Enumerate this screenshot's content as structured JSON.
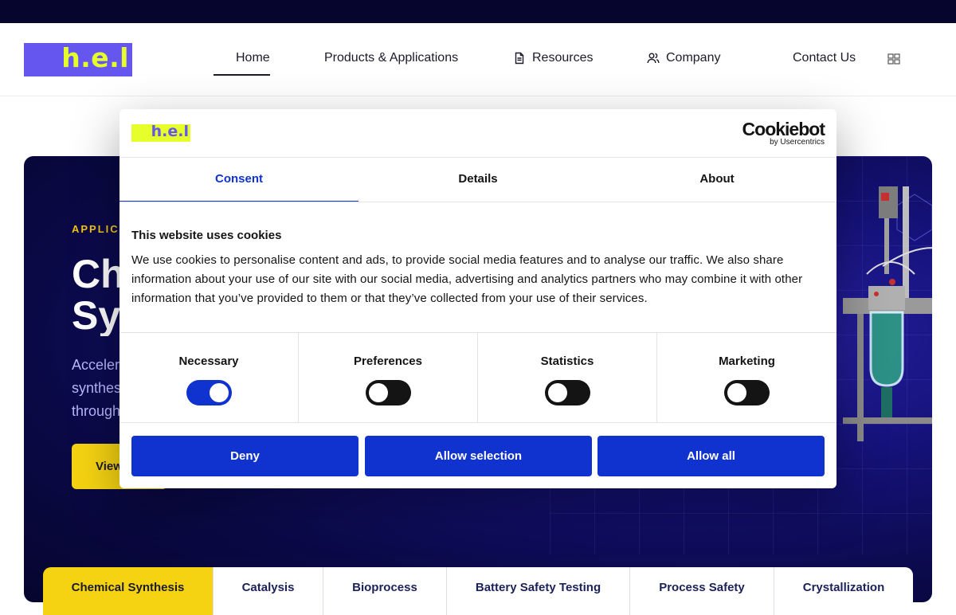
{
  "header": {
    "logo_text": "h.e.l",
    "nav": [
      {
        "label": "Home",
        "icon": null
      },
      {
        "label": "Products & Applications",
        "icon": null
      },
      {
        "label": "Resources",
        "icon": "document-icon"
      },
      {
        "label": "Company",
        "icon": "users-icon"
      },
      {
        "label": "Contact Us",
        "icon": null
      }
    ],
    "active_nav": "Home"
  },
  "hero": {
    "eyebrow": "APPLICA",
    "title_line1": "Ch",
    "title_line2": "Sy",
    "subtitle_line1": "Acceler",
    "subtitle_line2": "synthes",
    "subtitle_line3": "through",
    "button_label": "View"
  },
  "application_tabs": [
    "Chemical Synthesis",
    "Catalysis",
    "Bioprocess",
    "Battery Safety Testing",
    "Process Safety",
    "Crystallization"
  ],
  "cookie_dialog": {
    "logo_text": "h.e.l",
    "provider_name": "Cookiebot",
    "provider_sub": "by Usercentrics",
    "tabs": [
      "Consent",
      "Details",
      "About"
    ],
    "active_tab": "Consent",
    "heading": "This website uses cookies",
    "body": "We use cookies to personalise content and ads, to provide social media features and to analyse our traffic. We also share information about your use of our site with our social media, advertising and analytics partners who may combine it with other information that you’ve provided to them or that they’ve collected from your use of their services.",
    "categories": [
      {
        "label": "Necessary",
        "enabled": true
      },
      {
        "label": "Preferences",
        "enabled": false
      },
      {
        "label": "Statistics",
        "enabled": false
      },
      {
        "label": "Marketing",
        "enabled": false
      }
    ],
    "buttons": {
      "deny": "Deny",
      "allow_selection": "Allow selection",
      "allow_all": "Allow all"
    }
  },
  "colors": {
    "brand_purple": "#6556f0",
    "brand_lime": "#e6ff2b",
    "accent_yellow": "#f5d312",
    "consent_blue": "#1032cf",
    "hero_navy": "#0a0946"
  }
}
